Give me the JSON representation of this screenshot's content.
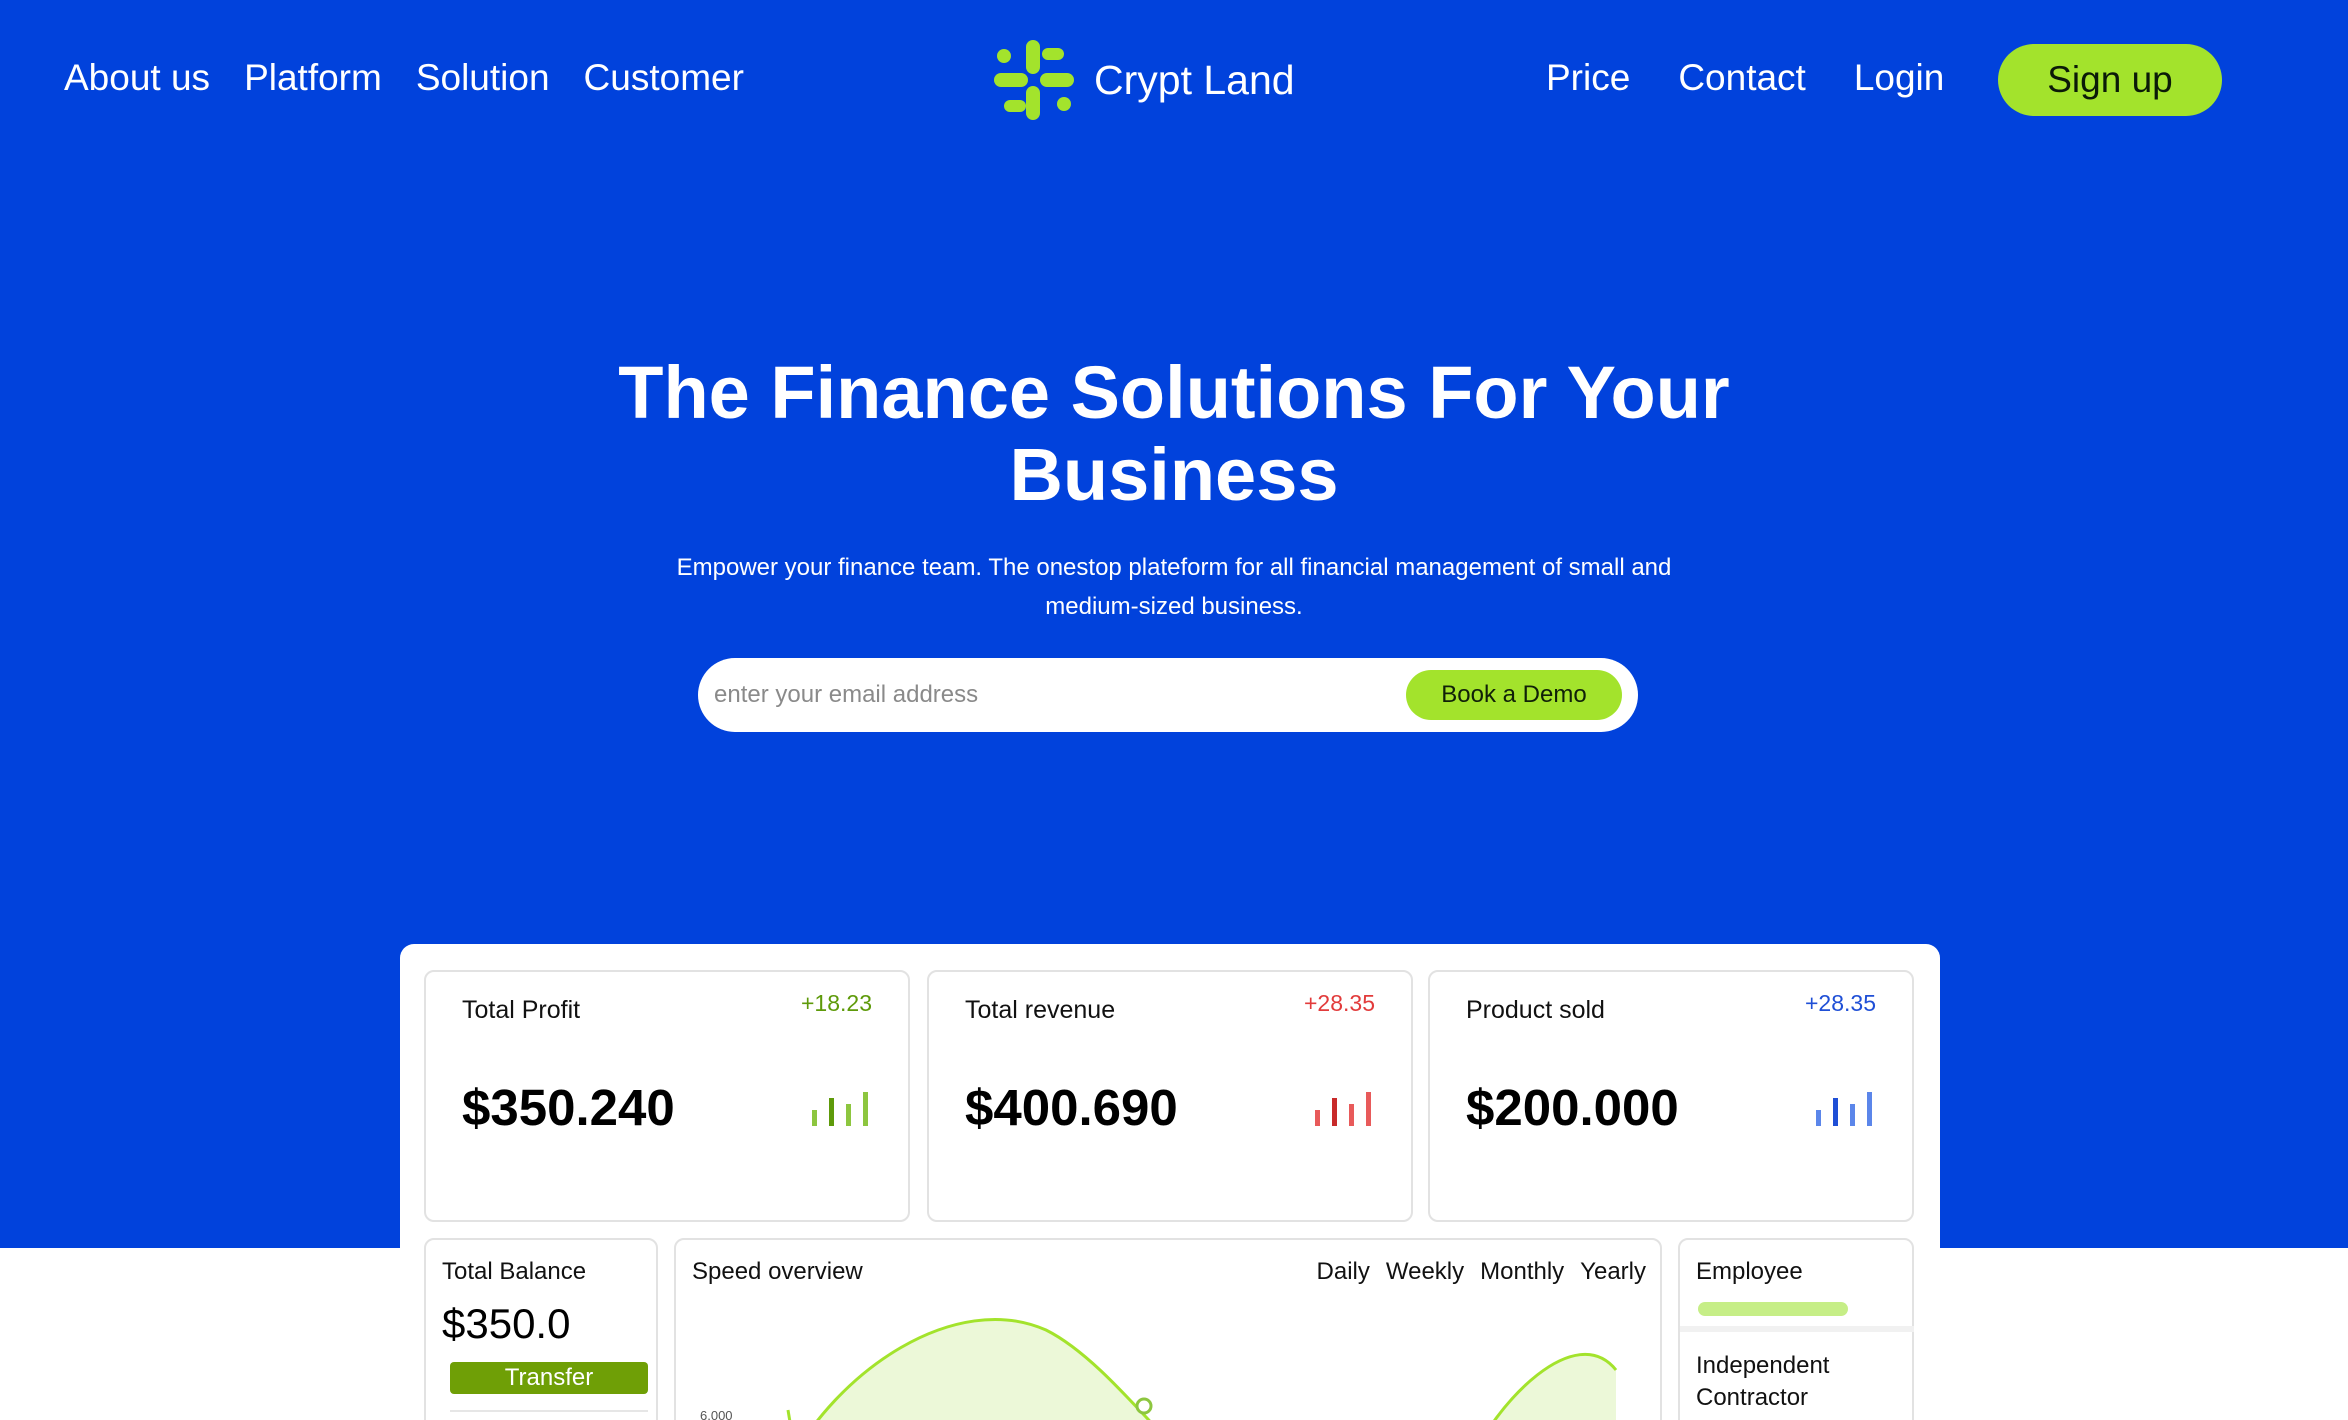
{
  "nav": {
    "left_links": [
      "About us",
      "Platform",
      "Solution",
      "Customer"
    ],
    "brand_name": "Crypt Land",
    "right_links": [
      "Price",
      "Contact",
      "Login"
    ],
    "signup_label": "Sign up"
  },
  "hero": {
    "title": "The Finance Solutions For Your Business",
    "subtitle": "Empower your finance team. The onestop plateform for all financial management of small and medium-sized business.",
    "email_placeholder": "enter your email address",
    "demo_button": "Book a Demo"
  },
  "dashboard": {
    "stats": [
      {
        "label": "Total Profit",
        "change": "+18.23",
        "value": "$350.240",
        "color": "#5e9a0a",
        "bar_color": "#8dc63f"
      },
      {
        "label": "Total revenue",
        "change": "+28.35",
        "value": "$400.690",
        "color": "#e23b3b",
        "bar_color": "#e85a5a"
      },
      {
        "label": "Product sold",
        "change": "+28.35",
        "value": "$200.000",
        "color": "#1f4fd6",
        "bar_color": "#3567e2"
      }
    ],
    "balance": {
      "title": "Total Balance",
      "value": "$350.0",
      "transfer_label": "Transfer"
    },
    "overview": {
      "title": "Speed overview",
      "tabs": [
        "Daily",
        "Weekly",
        "Monthly",
        "Yearly"
      ],
      "y_tick": "6,000"
    },
    "employee": {
      "title": "Employee",
      "item": "Independent Contractor"
    }
  },
  "colors": {
    "hero_bg": "#0142dc",
    "accent": "#a3e32c"
  }
}
